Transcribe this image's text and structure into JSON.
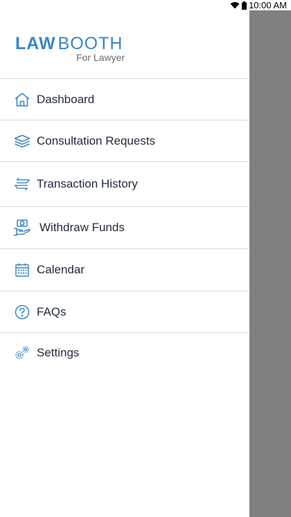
{
  "status_bar": {
    "time": "10:00 AM",
    "icons": [
      "wifi-icon",
      "battery-icon"
    ]
  },
  "logo": {
    "brand_first": "LAW",
    "brand_second": "BOOTH",
    "subtitle": "For Lawyer"
  },
  "colors": {
    "accent": "#3a86c4",
    "text": "#1f2a3a",
    "scrim": "#808080"
  },
  "menu": {
    "items": [
      {
        "label": "Dashboard",
        "icon": "home-icon"
      },
      {
        "label": "Consultation Requests",
        "icon": "layers-icon"
      },
      {
        "label": "Transaction History",
        "icon": "transfer-arrows-icon"
      },
      {
        "label": "Withdraw Funds",
        "icon": "hand-money-icon"
      },
      {
        "label": "Calendar",
        "icon": "calendar-icon"
      },
      {
        "label": "FAQs",
        "icon": "question-circle-icon"
      },
      {
        "label": "Settings",
        "icon": "gears-icon"
      }
    ]
  }
}
